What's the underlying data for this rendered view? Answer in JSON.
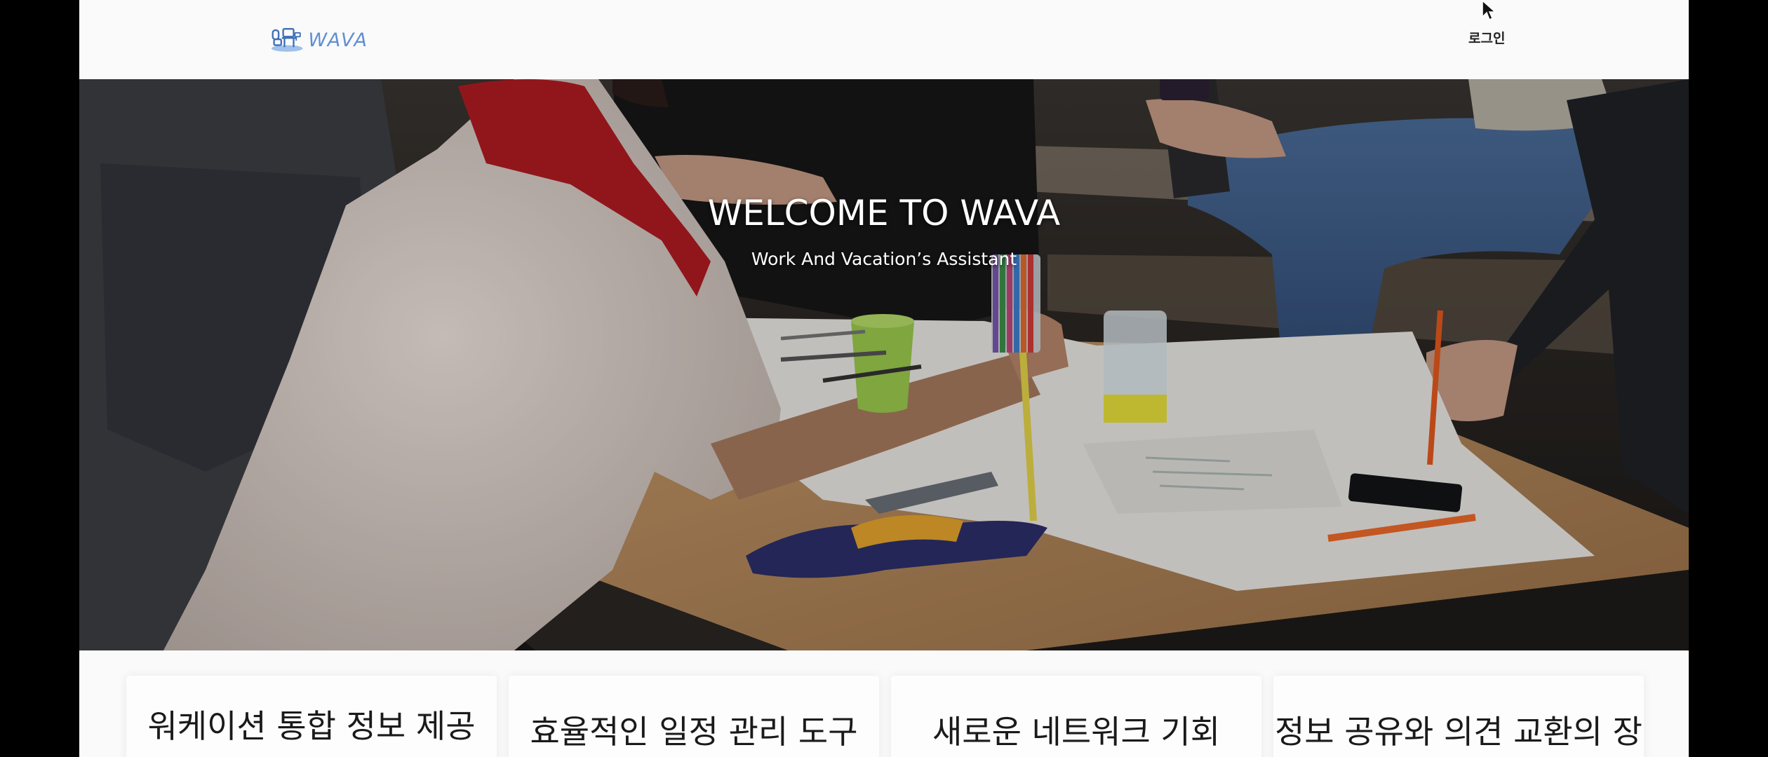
{
  "header": {
    "logo_text": "WAVA",
    "login_label": "로그인"
  },
  "hero": {
    "title": "WELCOME TO WAVA",
    "subtitle": "Work And Vacation’s Assistant"
  },
  "features": [
    {
      "title": "워케이션 통합 정보 제공"
    },
    {
      "title": "효율적인 일정 관리 도구"
    },
    {
      "title": "새로운 네트워크 기회"
    },
    {
      "title": "정보 공유와 의견 교환의 장"
    }
  ],
  "icons": {
    "logo": "wava-logo-icon",
    "cursor": "mouse-pointer-icon"
  },
  "colors": {
    "brand": "#5f8fd3",
    "page_background": "#fafafa",
    "outer_background": "#000000"
  }
}
